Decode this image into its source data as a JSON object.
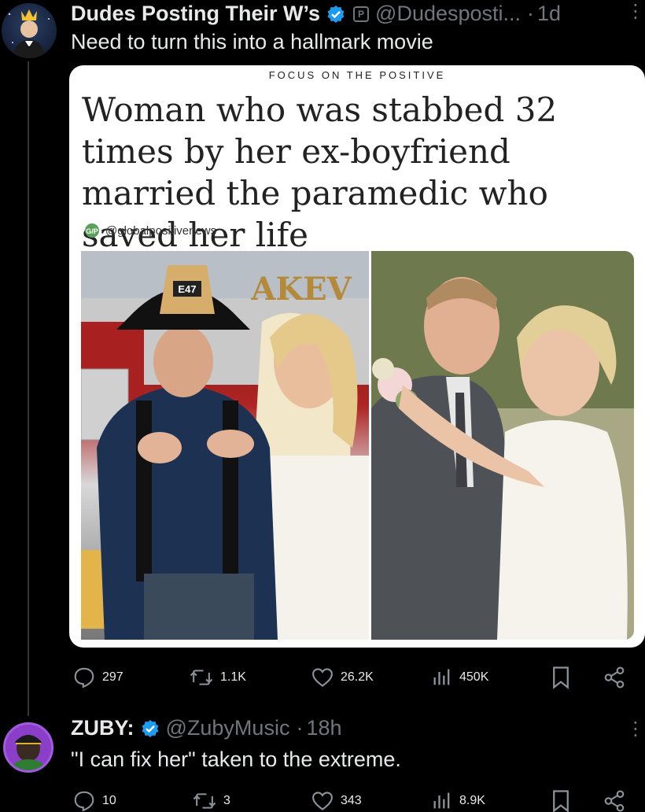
{
  "tweet1": {
    "display_name": "Dudes Posting Their W’s",
    "handle": "@Dudesposti...",
    "separator": "·",
    "time": "1d",
    "badge": "P",
    "text": "Need to turn this into a hallmark movie",
    "card": {
      "kicker": "FOCUS ON THE POSITIVE",
      "headline": "Woman who was stabbed 32 times by her ex-boyfriend married the paramedic who saved her life",
      "source_handle": "@globalpositivenews",
      "helmet_text": "E47",
      "truck_text": "AKEV"
    },
    "stats": {
      "replies": "297",
      "reposts": "1.1K",
      "likes": "26.2K",
      "views": "450K"
    }
  },
  "tweet2": {
    "display_name": "ZUBY:",
    "handle": "@ZubyMusic",
    "separator": "·",
    "time": "18h",
    "text": "\"I can fix her\" taken to the extreme.",
    "stats": {
      "replies": "10",
      "reposts": "3",
      "likes": "343",
      "views": "8.9K"
    }
  },
  "colors": {
    "background": "#000000",
    "text": "#e7e9ea",
    "muted": "#71767b",
    "verified": "#1d9bf0"
  }
}
